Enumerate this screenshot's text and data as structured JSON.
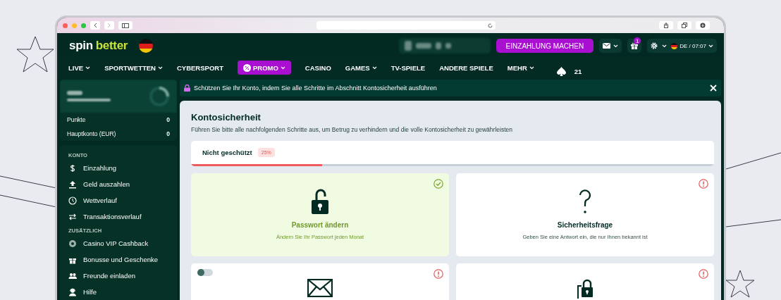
{
  "header": {
    "logo": {
      "first": "spin",
      "second": "better"
    },
    "deposit_button": "EINZAHLUNG MACHEN",
    "gift_badge": "1",
    "language": "DE",
    "separator": "/",
    "time": "07:07"
  },
  "nav": [
    {
      "label": "LIVE",
      "dropdown": true,
      "kind": "link"
    },
    {
      "label": "SPORTWETTEN",
      "dropdown": true,
      "kind": "link"
    },
    {
      "label": "CYBERSPORT",
      "dropdown": false,
      "kind": "link"
    },
    {
      "label": "PROMO",
      "dropdown": true,
      "kind": "promo"
    },
    {
      "label": "CASINO",
      "dropdown": false,
      "kind": "link"
    },
    {
      "label": "GAMES",
      "dropdown": true,
      "kind": "link"
    },
    {
      "label": "TV-SPIELE",
      "dropdown": false,
      "kind": "link"
    },
    {
      "label": "ANDERE SPIELE",
      "dropdown": false,
      "kind": "link"
    },
    {
      "label": "MEHR",
      "dropdown": true,
      "kind": "link"
    },
    {
      "label": "21",
      "dropdown": false,
      "kind": "cards"
    }
  ],
  "sidebar": {
    "balances": [
      {
        "label": "Punkte",
        "value": "0"
      },
      {
        "label": "Hauptkonto (EUR)",
        "value": "0"
      }
    ],
    "sections": [
      {
        "heading": "KONTO",
        "items": [
          "Einzahlung",
          "Geld auszahlen",
          "Wettverlauf",
          "Transaktionsverlauf"
        ]
      },
      {
        "heading": "ZUSÄTZLICH",
        "items": [
          "Casino VIP Cashback",
          "Bonusse und Geschenke",
          "Freunde einladen",
          "Hilfe"
        ]
      }
    ]
  },
  "banner": {
    "text": "Schützen Sie Ihr Konto, indem Sie alle Schritte im Abschnitt Kontosicherheit ausführen"
  },
  "security": {
    "title": "Kontosicherheit",
    "subtitle": "Führen Sie bitte alle nachfolgenden Schritte aus, um Betrug zu verhindern und die volle Kontosicherheit zu gewährleisten",
    "progress": {
      "label": "Nicht geschützt",
      "percent": "25%",
      "level": 0.25
    },
    "cards": [
      {
        "title": "Passwort ändern",
        "description": "Ändern Sie Ihr Passwort jeden Monat",
        "done": true
      },
      {
        "title": "Sicherheitsfrage",
        "description": "Geben Sie eine Antwort ein, die nur Ihnen bekannt ist",
        "done": false
      },
      {
        "done": false,
        "toggle": {
          "on": false
        }
      },
      {
        "done": false
      }
    ]
  }
}
